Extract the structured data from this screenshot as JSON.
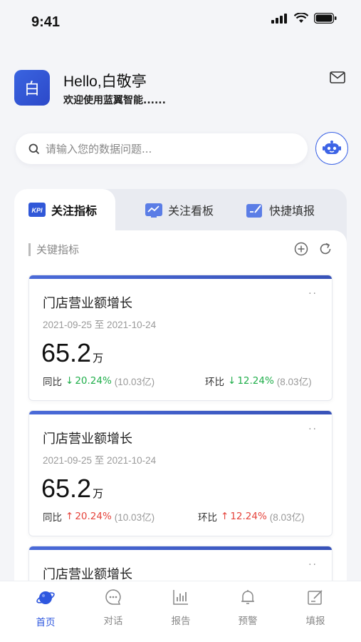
{
  "status": {
    "time": "9:41"
  },
  "header": {
    "avatar_text": "白",
    "greeting": "Hello,白敬亭",
    "welcome": "欢迎使用蓝翼智能......"
  },
  "search": {
    "placeholder": "请输入您的数据问题..."
  },
  "tabs": [
    {
      "label": "关注指标",
      "icon": "kpi-icon"
    },
    {
      "label": "关注看板",
      "icon": "dashboard-icon"
    },
    {
      "label": "快捷填报",
      "icon": "fill-form-icon"
    }
  ],
  "section": {
    "title": "关键指标"
  },
  "cards": [
    {
      "title": "门店营业额增长",
      "more": "··",
      "date": "2021-09-25 至 2021-10-24",
      "value": "65.2",
      "unit": "万",
      "yoy_label": "同比",
      "yoy_arrow": "↓",
      "yoy_value": "20.24%",
      "yoy_sub": "(10.03亿)",
      "mom_label": "环比",
      "mom_arrow": "↓",
      "mom_value": "12.24%",
      "mom_sub": "(8.03亿)",
      "trend_color": "#1fae4a"
    },
    {
      "title": "门店营业额增长",
      "more": "··",
      "date": "2021-09-25 至 2021-10-24",
      "value": "65.2",
      "unit": "万",
      "yoy_label": "同比",
      "yoy_arrow": "↑",
      "yoy_value": "20.24%",
      "yoy_sub": "(10.03亿)",
      "mom_label": "环比",
      "mom_arrow": "↑",
      "mom_value": "12.24%",
      "mom_sub": "(8.03亿)",
      "trend_color": "#e5443c"
    },
    {
      "title": "门店营业额增长",
      "more": "··"
    }
  ],
  "nav": [
    {
      "label": "首页",
      "icon": "home-planet-icon",
      "active": true
    },
    {
      "label": "对话",
      "icon": "chat-icon"
    },
    {
      "label": "报告",
      "icon": "report-icon"
    },
    {
      "label": "预警",
      "icon": "bell-icon"
    },
    {
      "label": "填报",
      "icon": "edit-form-icon"
    }
  ],
  "colors": {
    "accent": "#2e57df",
    "up": "#e5443c",
    "down": "#1fae4a"
  }
}
